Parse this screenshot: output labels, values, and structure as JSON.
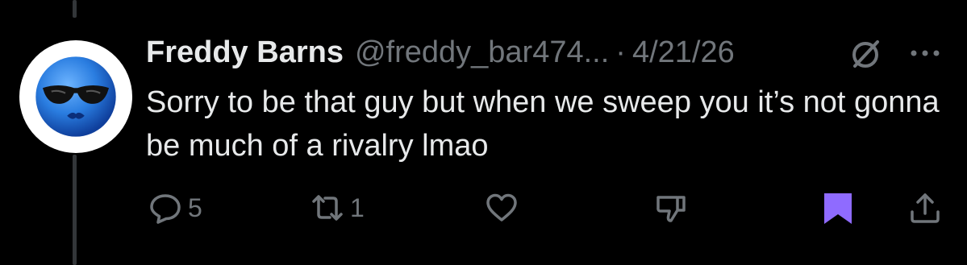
{
  "post": {
    "author_name": "Freddy Barns",
    "handle": "@freddy_bar474...",
    "separator": "·",
    "date": "4/21/26",
    "text": "Sorry to be that guy but when we sweep you it’s not gonna be much of a rivalry lmao"
  },
  "actions": {
    "reply_count": "5",
    "repost_count": "1"
  },
  "icons": {
    "avatar": "blue-face-sunglasses-avatar",
    "grok": "grok-icon",
    "more": "more-dots-icon",
    "reply": "reply-bubble-icon",
    "repost": "repost-icon",
    "like": "heart-icon",
    "dislike": "thumbs-down-icon",
    "bookmark": "bookmark-icon",
    "share": "share-icon"
  },
  "colors": {
    "background": "#000000",
    "text": "#e7e9ea",
    "muted": "#71767b",
    "bookmark_active": "#8f6bff",
    "thread_line": "#333639",
    "avatar_face": "#2a7de0"
  }
}
